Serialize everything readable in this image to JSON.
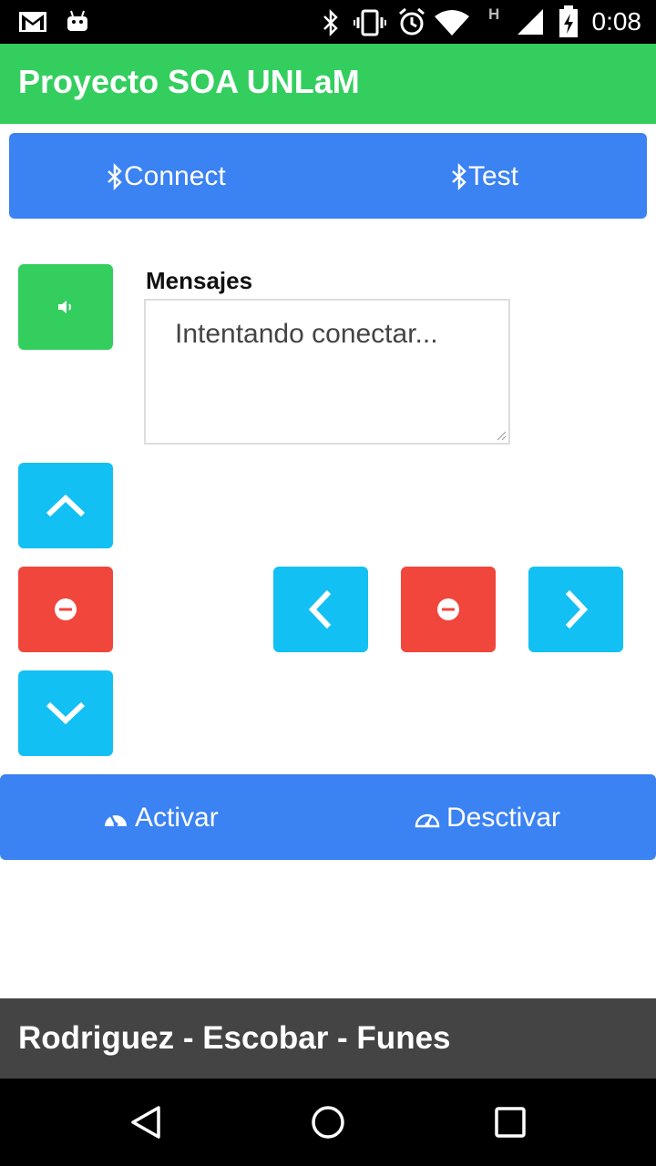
{
  "status_bar": {
    "time": "0:08",
    "network_letter": "H",
    "icons": [
      "gmail-icon",
      "android-icon",
      "bluetooth-icon",
      "vibrate-icon",
      "alarm-icon",
      "wifi-icon",
      "cell-signal-icon",
      "battery-charging-icon"
    ]
  },
  "app": {
    "title": "Proyecto SOA UNLaM"
  },
  "bluetooth_bar": {
    "connect_label": "Connect",
    "test_label": "Test"
  },
  "messages": {
    "label": "Mensajes",
    "text": "Intentando conectar..."
  },
  "controls": {
    "sound": "speaker-icon",
    "up": "chevron-up-icon",
    "down": "chevron-down-icon",
    "left": "chevron-left-icon",
    "right": "chevron-right-icon",
    "stop": "minus-circle-icon"
  },
  "sensor_bar": {
    "activate_label": "Activar",
    "deactivate_label": "Desctivar"
  },
  "footer": {
    "text": "Rodriguez - Escobar - Funes"
  },
  "colors": {
    "green": "#34ce5f",
    "blue": "#3b82f2",
    "cyan": "#13c0f3",
    "red": "#f1463b",
    "footer": "#444444"
  }
}
